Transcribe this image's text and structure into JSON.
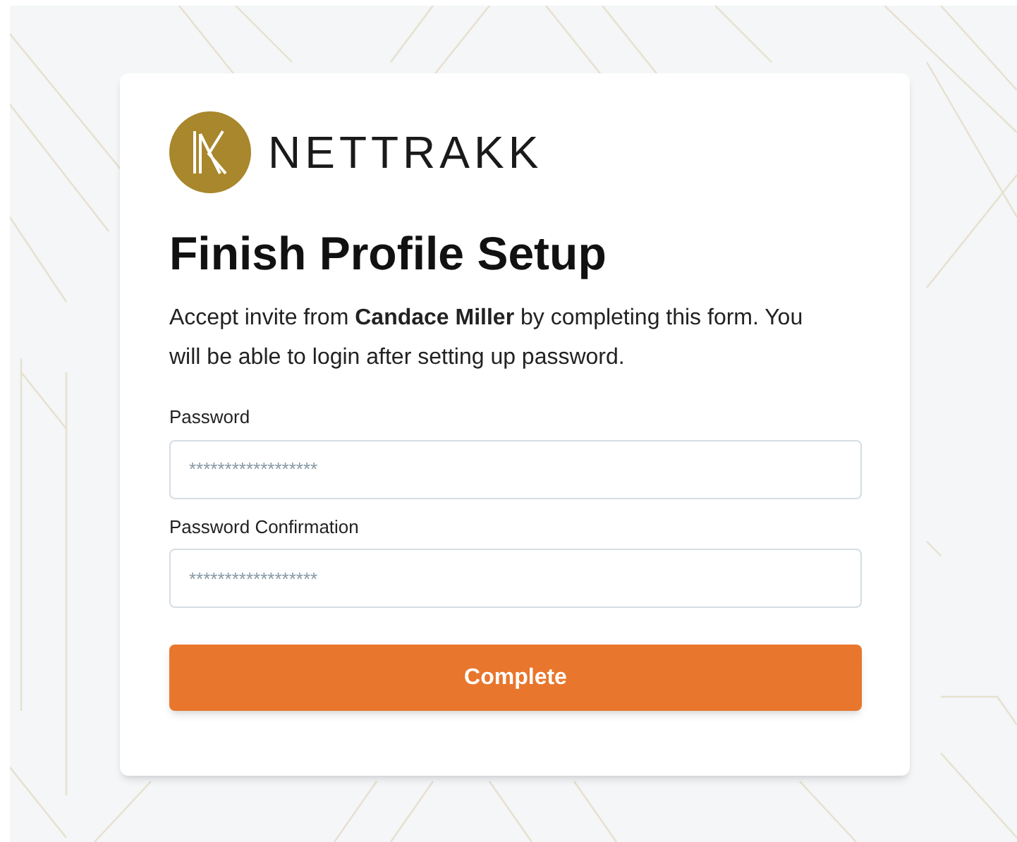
{
  "brand": {
    "name": "NETTRAKK"
  },
  "title": "Finish Profile Setup",
  "intro": "Accept invite from **Candace Miller** by completing this form. You will be able to login after setting up password.",
  "fields": [
    {
      "label": "Password",
      "placeholder": "******************"
    },
    {
      "label": "Password Confirmation",
      "placeholder": "******************"
    }
  ],
  "submit": {
    "label": "Complete"
  }
}
